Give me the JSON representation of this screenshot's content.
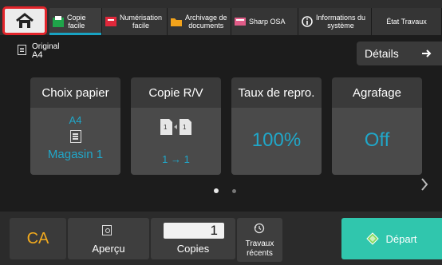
{
  "top": {
    "home_icon": "home-icon",
    "tabs": [
      {
        "label": "Copie\nfacile",
        "icon": "copy-icon",
        "active": true
      },
      {
        "label": "Numérisation\nfacile",
        "icon": "scan-icon",
        "active": false
      },
      {
        "label": "Archivage de\ndocuments",
        "icon": "folder-icon",
        "active": false
      },
      {
        "label": "Sharp OSA",
        "icon": "osa-icon",
        "active": false
      },
      {
        "label": "Informations du\nsystème",
        "icon": "info-icon",
        "active": false
      },
      {
        "label": "État Travaux",
        "icon": "",
        "active": false
      }
    ]
  },
  "original": {
    "label": "Original",
    "value": "A4"
  },
  "details": {
    "label": "Détails",
    "icon": "arrow-right-icon"
  },
  "cards": {
    "paper": {
      "title": "Choix papier",
      "size": "A4",
      "tray": "Magasin 1"
    },
    "duplex": {
      "title": "Copie R/V",
      "value": "1 → 1"
    },
    "ratio": {
      "title": "Taux de repro.",
      "value": "100%"
    },
    "staple": {
      "title": "Agrafage",
      "value": "Off"
    }
  },
  "pager": {
    "pages": 2,
    "current": 1
  },
  "bottom": {
    "ca": "CA",
    "preview": "Aperçu",
    "copies_value": "1",
    "copies_label": "Copies",
    "recent": "Travaux\nrécents",
    "start": "Départ"
  },
  "colors": {
    "accent": "#20a7c9",
    "home_border": "#e1252b",
    "ca": "#f0a91e",
    "start": "#30c6ad"
  }
}
